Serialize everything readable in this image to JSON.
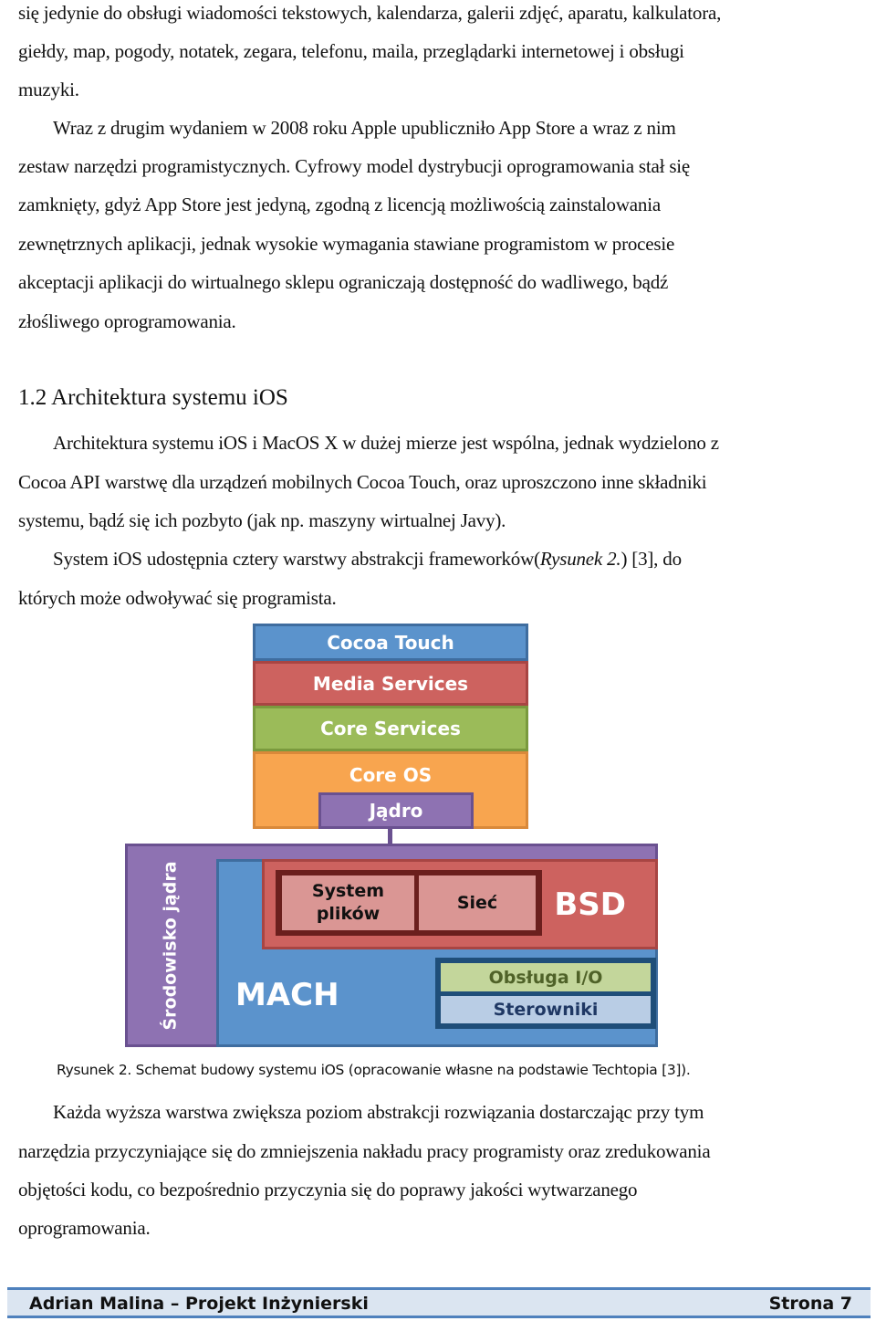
{
  "body_top": {
    "lines": [
      "się jedynie do obsługi wiadomości tekstowych, kalendarza, galerii zdjęć, aparatu, kalkulatora,",
      "giełdy, map, pogody,  notatek, zegara, telefonu, maila, przeglądarki internetowej i obsługi",
      "muzyki.",
      "Wraz z drugim wydaniem w 2008 roku Apple upubliczniło App Store a wraz z nim",
      "zestaw narzędzi programistycznych. Cyfrowy model dystrybucji oprogramowania stał się",
      "zamknięty, gdyż App Store jest jedyną, zgodną z licencją możliwością zainstalowania",
      "zewnętrznych aplikacji, jednak wysokie wymagania stawiane programistom w procesie",
      "akceptacji aplikacji do wirtualnego sklepu ograniczają dostępność do wadliwego, bądź",
      "złośliwego oprogramowania."
    ]
  },
  "section": {
    "heading": "1.2 Architektura systemu iOS",
    "lines": [
      "Architektura systemu iOS i MacOS X w dużej mierze jest wspólna, jednak wydzielono z",
      "Cocoa API warstwę dla urządzeń mobilnych Cocoa Touch, oraz uproszczono inne składniki",
      "systemu, bądź się ich pozbyto (jak np. maszyny wirtualnej Javy)."
    ],
    "ref_line": {
      "before": "System iOS udostępnia cztery warstwy abstrakcji frameworków(",
      "italic": "Rysunek 2.",
      "after": ") [3], do"
    },
    "ref_line_2": "których może odwoływać się programista."
  },
  "diagram": {
    "layers": {
      "cocoa_touch": "Cocoa Touch",
      "media_services": "Media Services",
      "core_services": "Core Services",
      "core_os": "Core OS",
      "kernel": "Jądro"
    },
    "kernel_env": {
      "side_label": "Środowisko jądra",
      "mach": "MACH",
      "bsd": "BSD",
      "filesystem": "System plików",
      "network": "Sieć",
      "io": "Obsługa I/O",
      "drivers": "Sterowniki"
    },
    "colors": {
      "blue": "#5b93cc",
      "red": "#cd625f",
      "green": "#9bbb59",
      "orange": "#f8a54f",
      "purple": "#8e72b2",
      "pink": "#da9694",
      "light_green": "#c3d69b",
      "light_blue": "#b9cde5"
    }
  },
  "caption": "Rysunek 2. Schemat budowy systemu iOS (opracowanie własne na podstawie Techtopia [3]).",
  "body_bottom": {
    "lines": [
      "Każda wyższa warstwa zwiększa poziom abstrakcji rozwiązania dostarczając przy tym",
      "narzędzia przyczyniające się do zmniejszenia nakładu pracy programisty oraz zredukowania",
      "objętości kodu, co bezpośrednio przyczynia się do poprawy jakości wytwarzanego",
      "oprogramowania."
    ]
  },
  "footer": {
    "left": "Adrian Malina – Projekt Inżynierski",
    "right": "Strona 7"
  }
}
